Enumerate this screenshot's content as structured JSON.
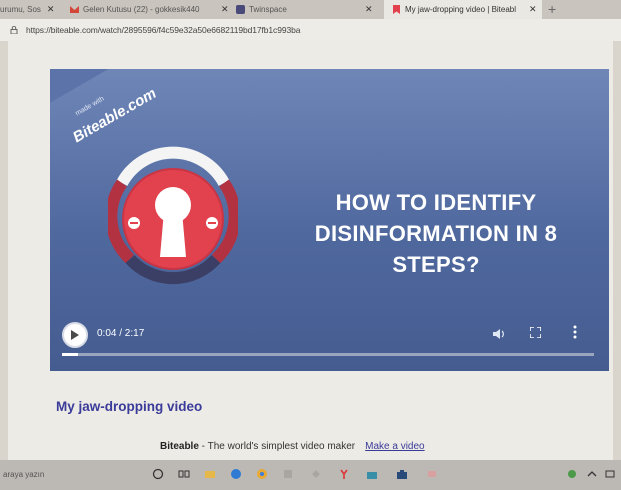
{
  "browser": {
    "tabs": [
      {
        "label": "urumu, Sos",
        "active": false
      },
      {
        "label": "Gelen Kutusu (22) - gokkesik440",
        "active": false
      },
      {
        "label": "Twinspace",
        "active": false
      },
      {
        "label": "My jaw-dropping video | Biteabl",
        "active": true
      }
    ],
    "close_glyph": "✕",
    "new_tab_glyph": "+",
    "url": "https://biteable.com/watch/2895596/f4c59e32a50e6682119bd17fb1c993ba"
  },
  "player": {
    "watermark_small": "made with",
    "watermark_brand": "Biteable.com",
    "headline_lines": [
      "HOW TO IDENTIFY",
      "DISINFORMATION IN 8",
      "STEPS?"
    ],
    "time": "0:04 / 2:17",
    "progress": 0.03,
    "colors": {
      "background": "#546ea3",
      "lock_red": "#e2414e",
      "lock_ring": "#ffffff"
    }
  },
  "page": {
    "video_title": "My jaw-dropping video",
    "footer_brand": "Biteable",
    "footer_text": " - The world's simplest video maker",
    "footer_link": "Make a video"
  },
  "taskbar": {
    "search_placeholder": "araya yazın"
  }
}
